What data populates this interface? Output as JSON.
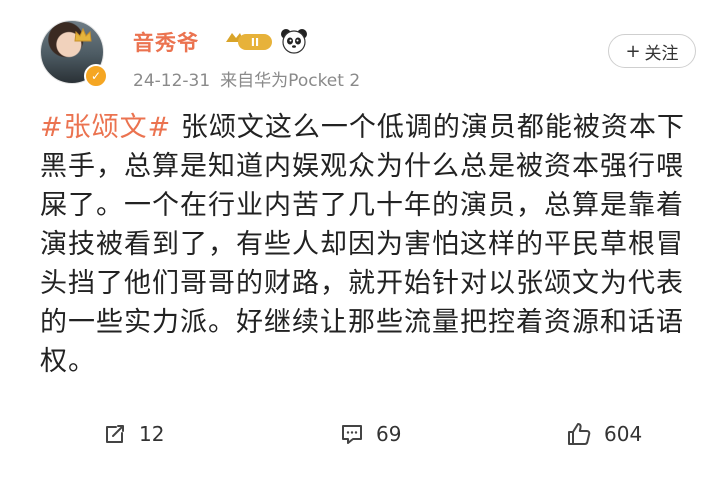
{
  "post": {
    "username": "音秀爷",
    "level": "II",
    "timestamp": "24-12-31",
    "source": "来自华为Pocket 2",
    "follow_label": "关注",
    "follow_prefix": "+",
    "hashtag": "#张颂文#",
    "body": "张颂文这么一个低调的演员都能被资本下黑手，总算是知道内娱观众为什么总是被资本强行喂屎了。一个在行业内苦了几十年的演员，总算是靠着演技被看到了，有些人却因为害怕这样的平民草根冒头挡了他们哥哥的财路，就开始针对以张颂文为代表的一些实力派。好继续让那些流量把控着资源和话语权。"
  },
  "actions": {
    "repost_count": "12",
    "comment_count": "69",
    "like_count": "604"
  },
  "icons": {
    "avatar": "avatar",
    "verified": "verified-badge-icon",
    "crown": "crown-icon",
    "level": "level-badge-icon",
    "panda": "panda-icon",
    "repost": "repost-icon",
    "comment": "comment-icon",
    "like": "thumbs-up-icon"
  },
  "colors": {
    "accent": "#eb7350",
    "meta_gray": "#8a8a8a",
    "verified": "#f5a623"
  }
}
